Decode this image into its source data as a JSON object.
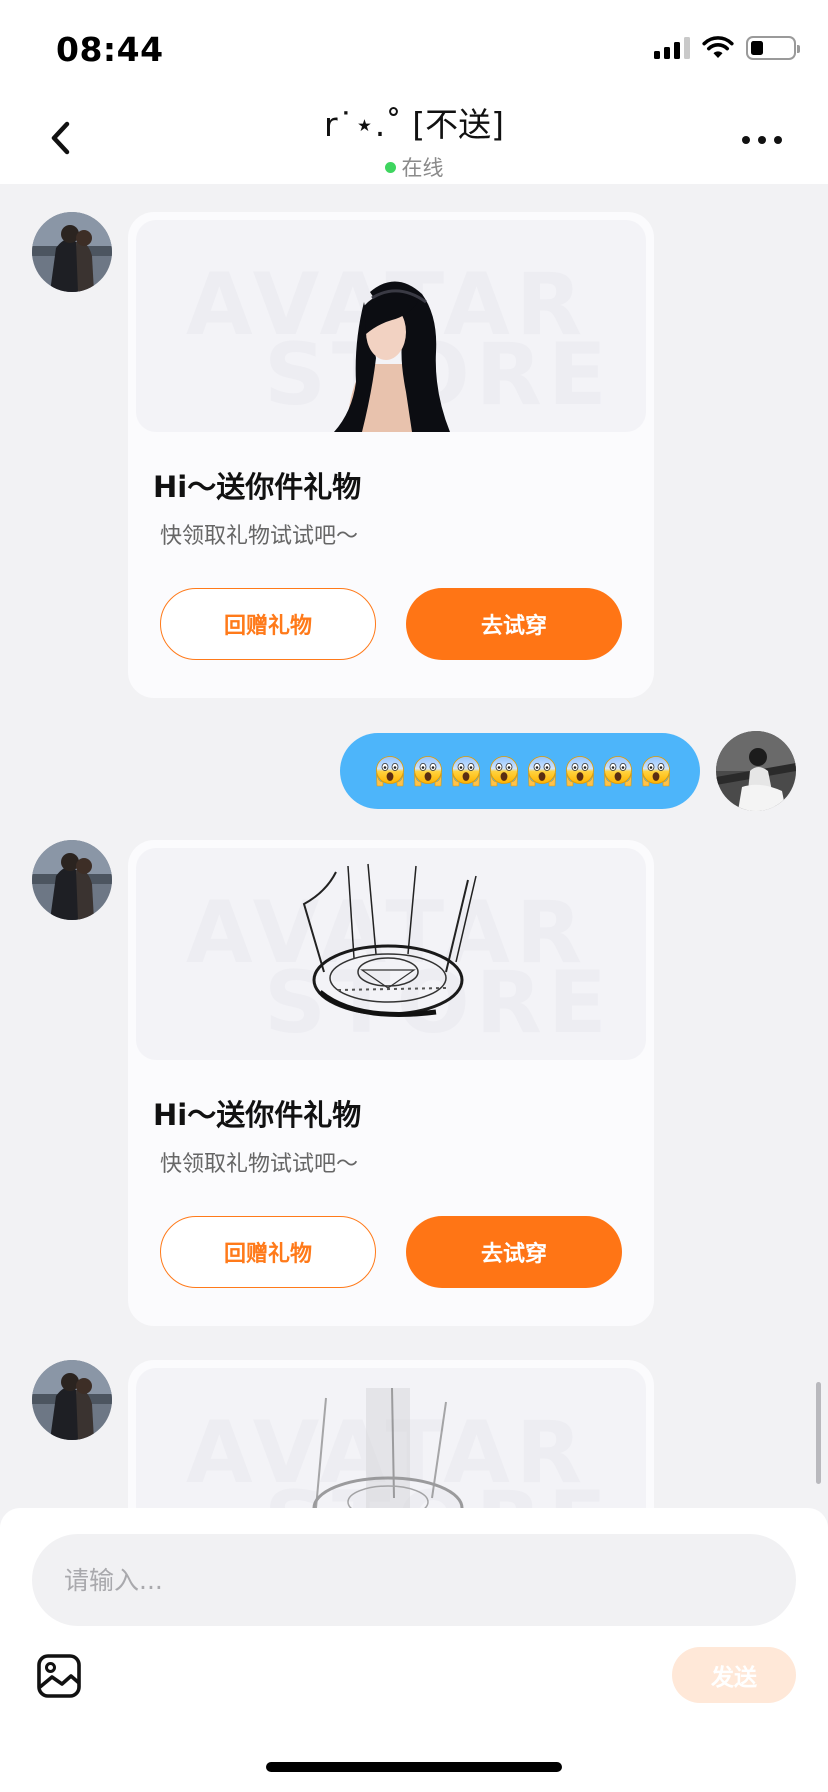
{
  "status_bar": {
    "time": "08:44",
    "icons": [
      "signal-icon",
      "wifi-icon",
      "battery-icon"
    ]
  },
  "header": {
    "back_icon": "chevron-left-icon",
    "title": "r˙⋆.˚ [不送]",
    "status": "在线",
    "status_color": "#3ed55f",
    "more_icon": "more-horizontal-icon"
  },
  "watermark": {
    "line1": "AVATAR",
    "line2": "STORE"
  },
  "messages": [
    {
      "type": "gift",
      "side": "left",
      "image": "girl-avatar-illustration",
      "title": "Hi～送你件礼物",
      "subtitle": "快领取礼物试试吧～",
      "secondary_button": "回赠礼物",
      "primary_button": "去试穿"
    },
    {
      "type": "text",
      "side": "right",
      "emoji_count": 8,
      "emoji_icon": "scream-emoji-icon"
    },
    {
      "type": "gift",
      "side": "left",
      "image": "magic-circle-cage-illustration",
      "title": "Hi～送你件礼物",
      "subtitle": "快领取礼物试试吧～",
      "secondary_button": "回赠礼物",
      "primary_button": "去试穿"
    },
    {
      "type": "gift",
      "side": "left",
      "image": "magic-circle-cage-illustration"
    }
  ],
  "input": {
    "placeholder": "请输入...",
    "image_icon": "image-icon",
    "send_label": "发送"
  },
  "colors": {
    "accent": "#ff7515",
    "bubble_mine": "#4db5fa",
    "send_disabled": "#ffe8d8",
    "background": "#f2f2f4"
  }
}
